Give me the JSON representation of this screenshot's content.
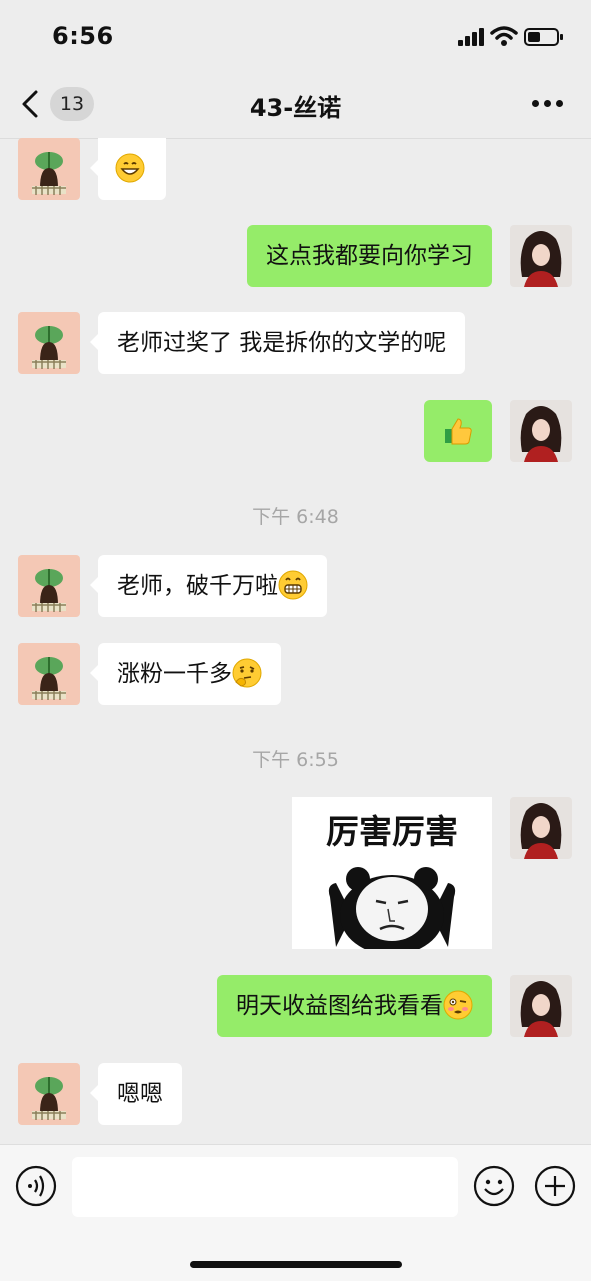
{
  "status_bar": {
    "time": "6:56"
  },
  "header": {
    "unread_count": "13",
    "title": "43-丝诺"
  },
  "messages": [
    {
      "side": "left",
      "text": "",
      "emoji": "grinning-emoji"
    },
    {
      "side": "right",
      "text": "这点我都要向你学习"
    },
    {
      "side": "left",
      "text": "老师过奖了 我是拆你的文学的呢"
    },
    {
      "side": "right",
      "text": "",
      "emoji": "thumbs-up-emoji"
    },
    {
      "timestamp": "下午 6:48"
    },
    {
      "side": "left",
      "text": "老师，破千万啦",
      "emoji": "big-grin-emoji"
    },
    {
      "side": "left",
      "text": "涨粉一千多",
      "emoji": "thinking-emoji"
    },
    {
      "timestamp": "下午 6:55"
    },
    {
      "side": "right",
      "sticker_text": "厉害厉害"
    },
    {
      "side": "right",
      "text": "明天收益图给我看看",
      "emoji": "woozy-emoji"
    },
    {
      "side": "left",
      "text": "嗯嗯"
    }
  ],
  "composer": {
    "input_value": ""
  },
  "colors": {
    "outgoing_bubble": "#95ec69",
    "incoming_bubble": "#ffffff",
    "background": "#ededed"
  }
}
